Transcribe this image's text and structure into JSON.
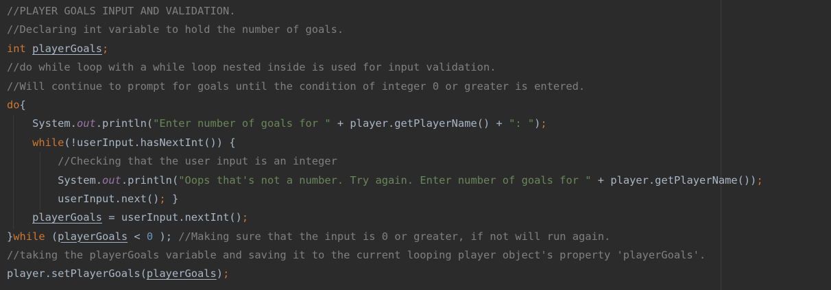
{
  "editor": {
    "theme_colors": {
      "background": "#2b2b2b",
      "default_text": "#a9b7c6",
      "comment": "#808080",
      "keyword": "#cc7832",
      "string": "#6a8759",
      "number": "#6897bb",
      "static_field": "#9876aa"
    },
    "lines": [
      [
        {
          "t": "cm",
          "v": "//PLAYER GOALS INPUT AND VALIDATION."
        }
      ],
      [
        {
          "t": "cm",
          "v": "//Declaring int variable to hold the number of goals."
        }
      ],
      [
        {
          "t": "kw",
          "v": "int "
        },
        {
          "t": "ul",
          "v": "playerGoals"
        },
        {
          "t": "kw",
          "v": ";"
        }
      ],
      [
        {
          "t": "cm",
          "v": "//do while loop with a while loop nested inside is used for input validation."
        }
      ],
      [
        {
          "t": "cm",
          "v": "//Will continue to prompt for goals until the condition of integer 0 or greater is entered."
        }
      ],
      [
        {
          "t": "kw",
          "v": "do"
        },
        {
          "t": "p",
          "v": "{"
        }
      ],
      [
        {
          "t": "p",
          "v": "    System."
        },
        {
          "t": "it",
          "v": "out"
        },
        {
          "t": "p",
          "v": ".println("
        },
        {
          "t": "st",
          "v": "\"Enter number of goals for \""
        },
        {
          "t": "p",
          "v": " + player.getPlayerName() + "
        },
        {
          "t": "st",
          "v": "\": \""
        },
        {
          "t": "p",
          "v": ")"
        },
        {
          "t": "kw",
          "v": ";"
        }
      ],
      [
        {
          "t": "p",
          "v": "    "
        },
        {
          "t": "kw",
          "v": "while"
        },
        {
          "t": "p",
          "v": "(!userInput.hasNextInt()) {"
        }
      ],
      [
        {
          "t": "cm",
          "v": "        //Checking that the user input is an integer"
        }
      ],
      [
        {
          "t": "p",
          "v": "        System."
        },
        {
          "t": "it",
          "v": "out"
        },
        {
          "t": "p",
          "v": ".println("
        },
        {
          "t": "st",
          "v": "\"Oops that's not a number. Try again. Enter number of goals for \""
        },
        {
          "t": "p",
          "v": " + player.getPlayerName())"
        },
        {
          "t": "kw",
          "v": ";"
        }
      ],
      [
        {
          "t": "p",
          "v": "        userInput.next()"
        },
        {
          "t": "kw",
          "v": "; "
        },
        {
          "t": "p",
          "v": "}"
        }
      ],
      [
        {
          "t": "p",
          "v": "    "
        },
        {
          "t": "ul",
          "v": "playerGoals"
        },
        {
          "t": "p",
          "v": " = userInput.nextInt()"
        },
        {
          "t": "kw",
          "v": ";"
        }
      ],
      [
        {
          "t": "p",
          "v": "}"
        },
        {
          "t": "kw",
          "v": "while "
        },
        {
          "t": "p",
          "v": "("
        },
        {
          "t": "ul",
          "v": "playerGoals"
        },
        {
          "t": "p",
          "v": " < "
        },
        {
          "t": "nm",
          "v": "0"
        },
        {
          "t": "p",
          "v": " ); "
        },
        {
          "t": "cm",
          "v": "//Making sure that the input is 0 or greater, if not will run again."
        }
      ],
      [
        {
          "t": "cm",
          "v": "//taking the playerGoals variable and saving it to the current looping player object's property 'playerGoals'."
        }
      ],
      [
        {
          "t": "p",
          "v": "player.setPlayerGoals("
        },
        {
          "t": "ul",
          "v": "playerGoals"
        },
        {
          "t": "p",
          "v": ")"
        },
        {
          "t": "kw",
          "v": ";"
        }
      ]
    ]
  }
}
